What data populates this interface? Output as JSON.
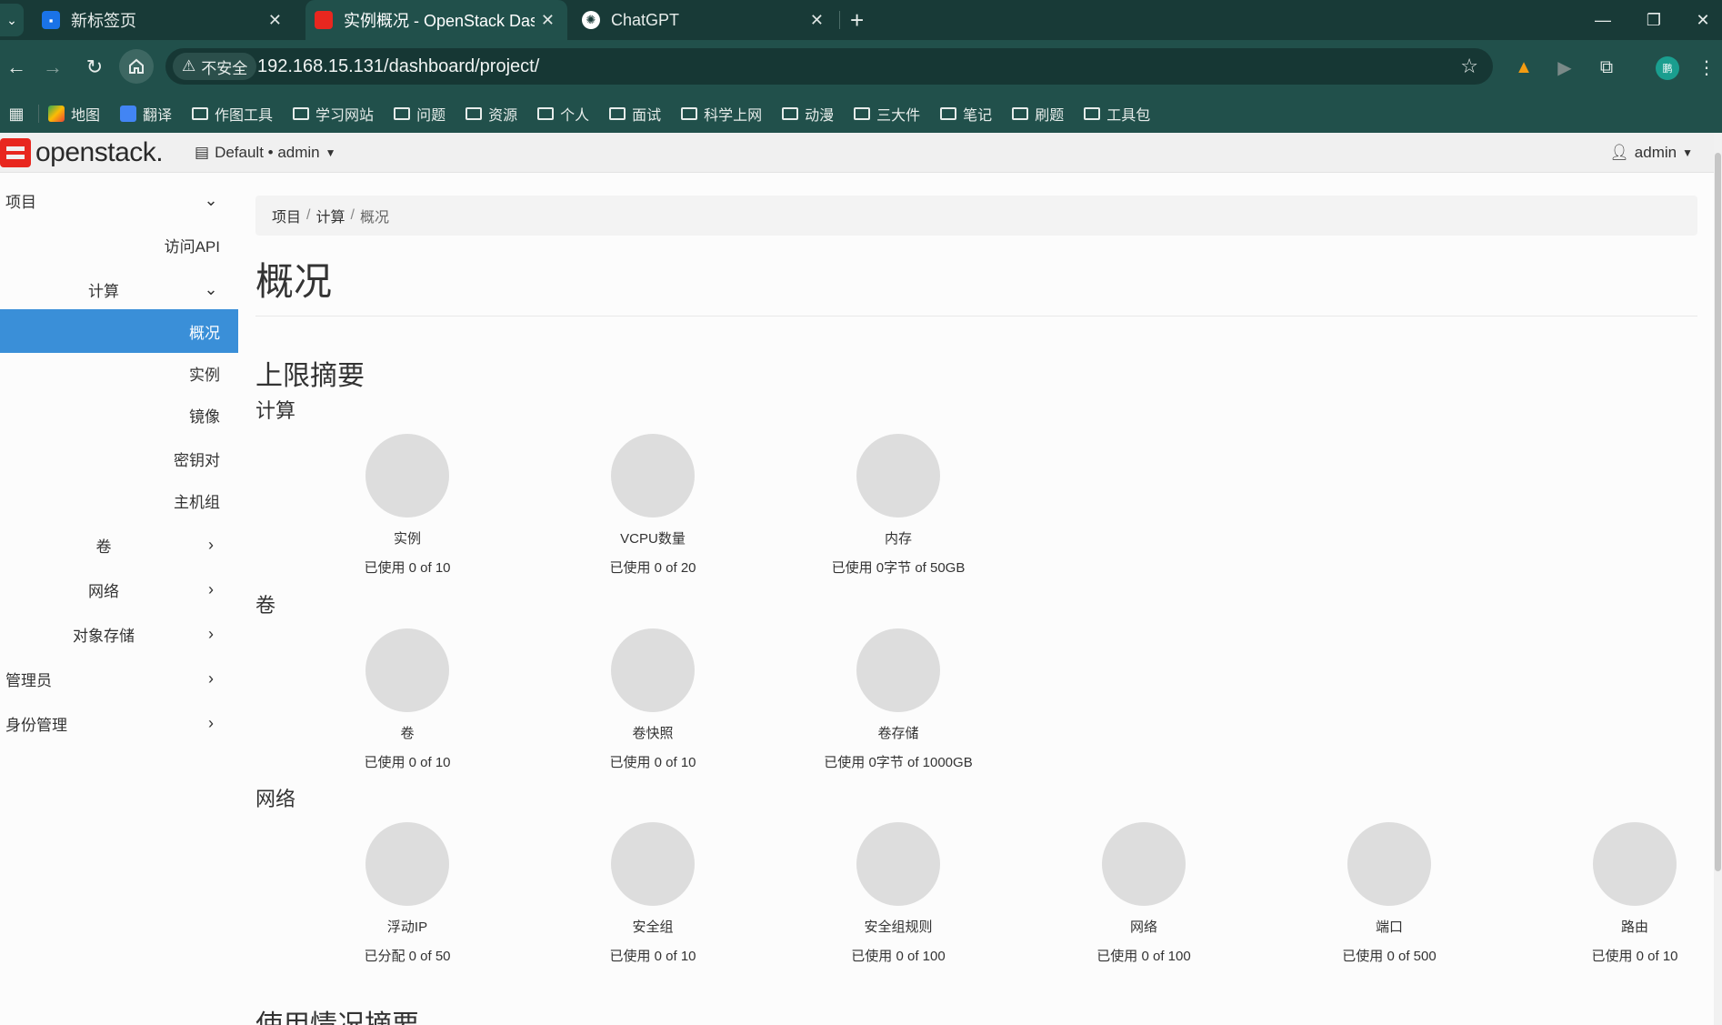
{
  "browser": {
    "tabs": [
      {
        "title": "新标签页",
        "close": "✕"
      },
      {
        "title": "实例概况 - OpenStack Dashbo",
        "close": "✕"
      },
      {
        "title": "ChatGPT",
        "close": "✕"
      }
    ],
    "new_tab": "+",
    "window_controls": {
      "minimize": "—",
      "restore": "❐",
      "close": "✕"
    },
    "security_label": "不安全",
    "url": "192.168.15.131/dashboard/project/",
    "profile_initial": "鹏",
    "bookmarks": [
      "地图",
      "翻译",
      "作图工具",
      "学习网站",
      "问题",
      "资源",
      "个人",
      "面试",
      "科学上网",
      "动漫",
      "三大件",
      "笔记",
      "刷题",
      "工具包"
    ]
  },
  "header": {
    "logo": "openstack.",
    "project_selector": "Default • admin",
    "user": "admin"
  },
  "sidebar": {
    "project": "项目",
    "api_access": "访问API",
    "compute": "计算",
    "compute_items": [
      "概况",
      "实例",
      "镜像",
      "密钥对",
      "主机组"
    ],
    "volumes": "卷",
    "network": "网络",
    "object_store": "对象存储",
    "admin": "管理员",
    "identity": "身份管理"
  },
  "breadcrumb": {
    "items": [
      "项目",
      "计算",
      "概况"
    ],
    "sep": "/"
  },
  "page_title": "概况",
  "limits": {
    "title": "上限摘要",
    "compute": {
      "title": "计算",
      "items": [
        {
          "name": "实例",
          "usage": "已使用 0 of 10"
        },
        {
          "name": "VCPU数量",
          "usage": "已使用 0 of 20"
        },
        {
          "name": "内存",
          "usage": "已使用 0字节 of 50GB"
        }
      ]
    },
    "volume": {
      "title": "卷",
      "items": [
        {
          "name": "卷",
          "usage": "已使用 0 of 10"
        },
        {
          "name": "卷快照",
          "usage": "已使用 0 of 10"
        },
        {
          "name": "卷存储",
          "usage": "已使用 0字节 of 1000GB"
        }
      ]
    },
    "network": {
      "title": "网络",
      "items": [
        {
          "name": "浮动IP",
          "usage": "已分配 0 of 50"
        },
        {
          "name": "安全组",
          "usage": "已使用 0 of 10"
        },
        {
          "name": "安全组规则",
          "usage": "已使用 0 of 100"
        },
        {
          "name": "网络",
          "usage": "已使用 0 of 100"
        },
        {
          "name": "端口",
          "usage": "已使用 0 of 500"
        },
        {
          "name": "路由",
          "usage": "已使用 0 of 10"
        }
      ]
    }
  },
  "usage_summary_title": "使用情况摘要",
  "colors": {
    "chrome_dark": "#183a37",
    "chrome": "#21504b",
    "accent": "#3a8fd8",
    "logo_red": "#e8271f",
    "pie_gray": "#dddddd"
  }
}
